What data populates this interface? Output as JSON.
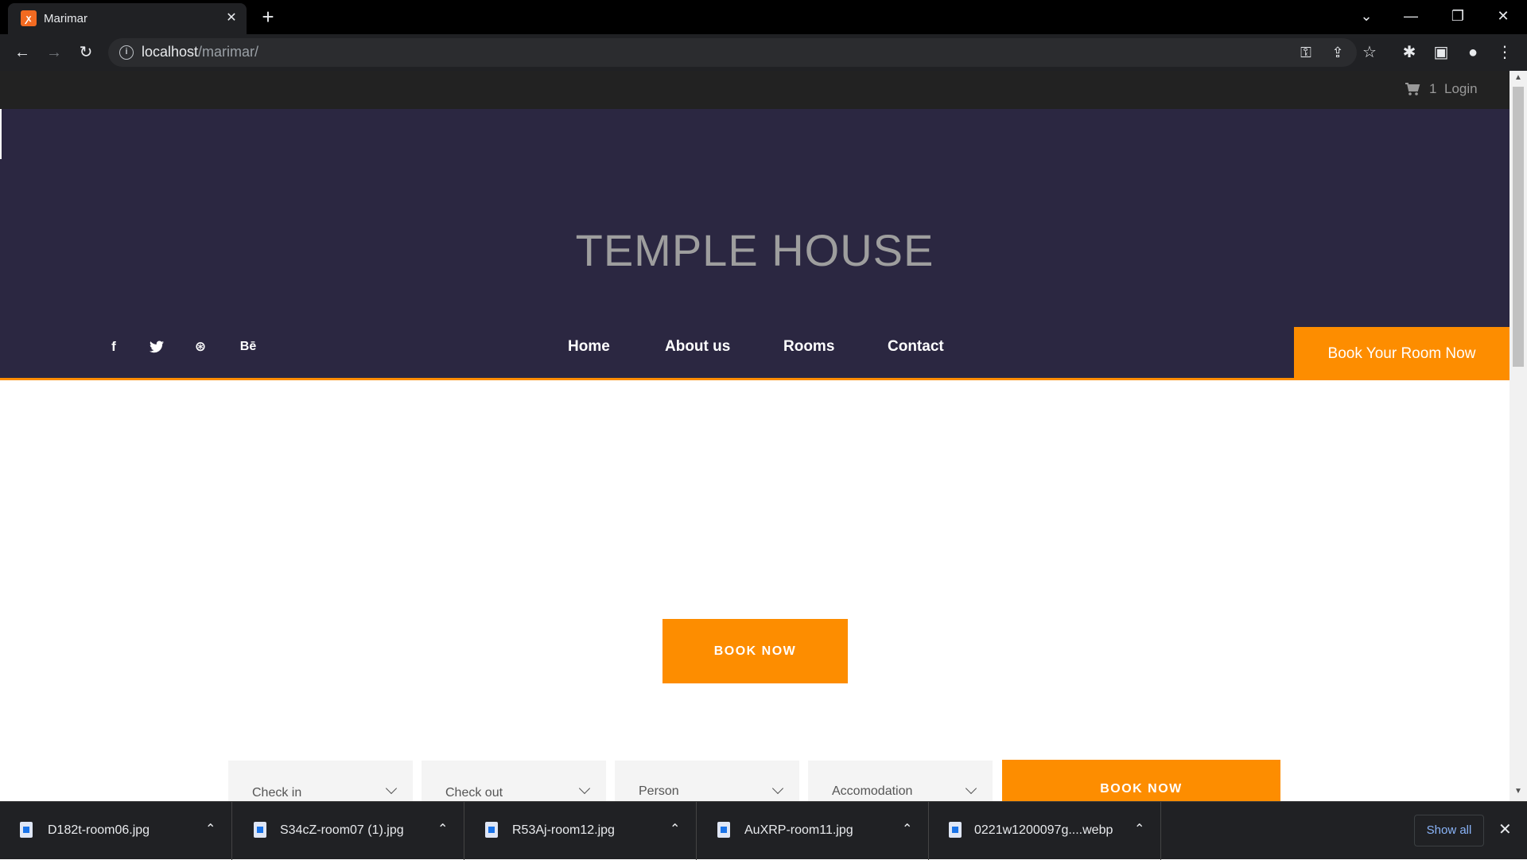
{
  "browser": {
    "tab_title": "Marimar",
    "tab_close": "✕",
    "new_tab": "+",
    "url_host": "localhost",
    "url_path": "/marimar/",
    "window_controls": {
      "minimize": "—",
      "restore": "❐",
      "close": "✕",
      "tab_search": "⌄"
    }
  },
  "topbar": {
    "cart_count": "1",
    "login_label": "Login"
  },
  "hero": {
    "site_title": "TEMPLE HOUSE",
    "social_icons": [
      "facebook-icon",
      "twitter-icon",
      "dribbble-icon",
      "behance-icon"
    ],
    "social_glyphs": {
      "facebook": "f",
      "twitter": "🐦",
      "dribbble": "⊛",
      "behance": "Bē"
    },
    "nav": [
      "Home",
      "About us",
      "Rooms",
      "Contact"
    ],
    "book_room_label": "Book Your Room Now"
  },
  "main": {
    "book_now_label": "BOOK NOW"
  },
  "booking_form": {
    "check_in": "Check in",
    "check_out": "Check out",
    "person": "Person",
    "accommodation": "Accomodation",
    "submit_label": "BOOK NOW"
  },
  "downloads": {
    "items": [
      "D182t-room06.jpg",
      "S34cZ-room07 (1).jpg",
      "R53Aj-room12.jpg",
      "AuXRP-room11.jpg",
      "0221w1200097g....webp"
    ],
    "show_all_label": "Show all",
    "close": "✕"
  },
  "colors": {
    "accent": "#fd8d00",
    "hero_bg": "#2b2741",
    "topbar_bg": "#222222"
  }
}
